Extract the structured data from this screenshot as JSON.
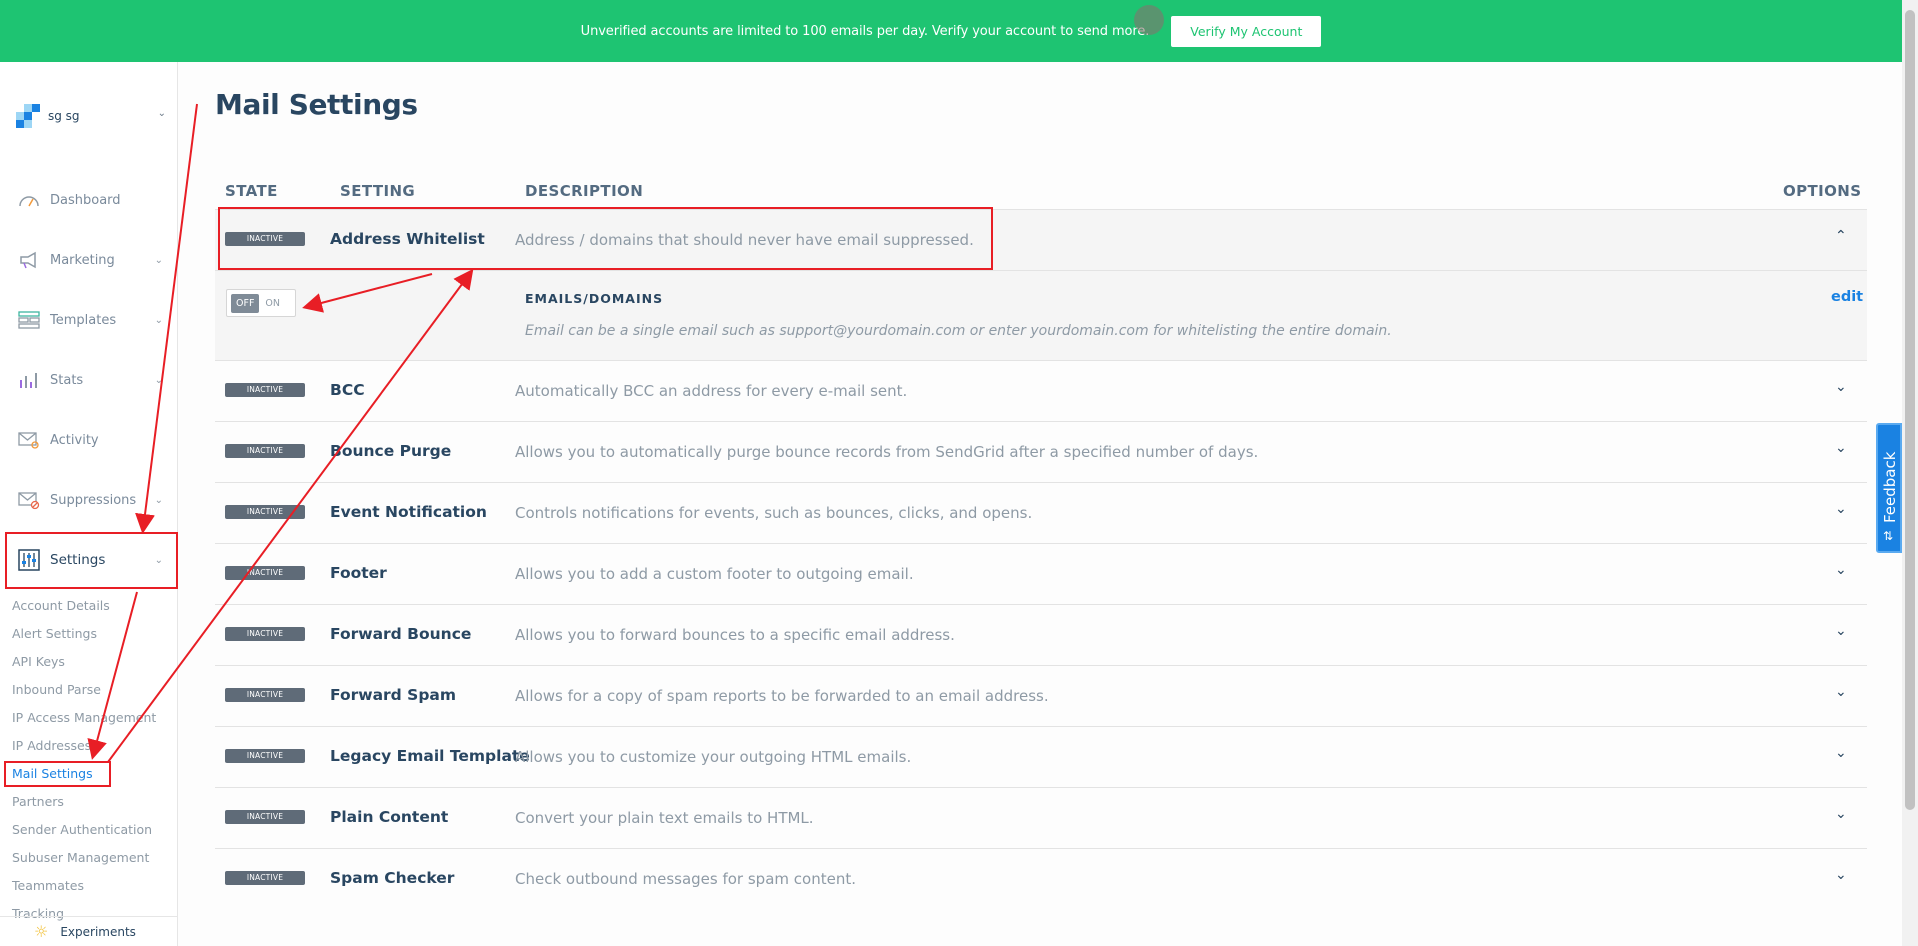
{
  "banner": {
    "text": "Unverified accounts are limited to 100 emails per day. Verify your account to send more.",
    "button": "Verify My Account"
  },
  "account": {
    "name": "sg sg"
  },
  "nav": [
    {
      "label": "Dashboard",
      "icon": "dashboard-icon",
      "chevron": false
    },
    {
      "label": "Marketing",
      "icon": "megaphone-icon",
      "chevron": true
    },
    {
      "label": "Templates",
      "icon": "templates-icon",
      "chevron": true
    },
    {
      "label": "Stats",
      "icon": "stats-icon",
      "chevron": true
    },
    {
      "label": "Activity",
      "icon": "activity-icon",
      "chevron": false
    },
    {
      "label": "Suppressions",
      "icon": "suppressions-icon",
      "chevron": true
    },
    {
      "label": "Settings",
      "icon": "settings-icon",
      "chevron": true
    }
  ],
  "settings_sub": [
    "Account Details",
    "Alert Settings",
    "API Keys",
    "Inbound Parse",
    "IP Access Management",
    "IP Addresses",
    "Mail Settings",
    "Partners",
    "Sender Authentication",
    "Subuser Management",
    "Teammates",
    "Tracking"
  ],
  "sidebar_footer": "Experiments",
  "page_title": "Mail Settings",
  "table": {
    "headers": {
      "state": "STATE",
      "setting": "SETTING",
      "description": "DESCRIPTION",
      "options": "OPTIONS"
    },
    "rows": [
      {
        "state": "INACTIVE",
        "name": "Address Whitelist",
        "description": "Address / domains that should never have email suppressed.",
        "expanded": true
      },
      {
        "state": "INACTIVE",
        "name": "BCC",
        "description": "Automatically BCC an address for every e-mail sent."
      },
      {
        "state": "INACTIVE",
        "name": "Bounce Purge",
        "description": "Allows you to automatically purge bounce records from SendGrid after a specified number of days."
      },
      {
        "state": "INACTIVE",
        "name": "Event Notification",
        "description": "Controls notifications for events, such as bounces, clicks, and opens."
      },
      {
        "state": "INACTIVE",
        "name": "Footer",
        "description": "Allows you to add a custom footer to outgoing email."
      },
      {
        "state": "INACTIVE",
        "name": "Forward Bounce",
        "description": "Allows you to forward bounces to a specific email address."
      },
      {
        "state": "INACTIVE",
        "name": "Forward Spam",
        "description": "Allows for a copy of spam reports to be forwarded to an email address."
      },
      {
        "state": "INACTIVE",
        "name": "Legacy Email Template",
        "description": "Allows you to customize your outgoing HTML emails."
      },
      {
        "state": "INACTIVE",
        "name": "Plain Content",
        "description": "Convert your plain text emails to HTML."
      },
      {
        "state": "INACTIVE",
        "name": "Spam Checker",
        "description": "Check outbound messages for spam content."
      }
    ]
  },
  "detail": {
    "toggle_off": "OFF",
    "toggle_on": "ON",
    "label": "EMAILS/DOMAINS",
    "help": "Email can be a single email such as support@yourdomain.com or enter yourdomain.com for whitelisting the entire domain.",
    "edit": "edit"
  },
  "feedback": "Feedback",
  "colors": {
    "brand_green": "#1ec472",
    "link_blue": "#1a82e2",
    "annotation_red": "#e81e25",
    "heading": "#294661"
  }
}
